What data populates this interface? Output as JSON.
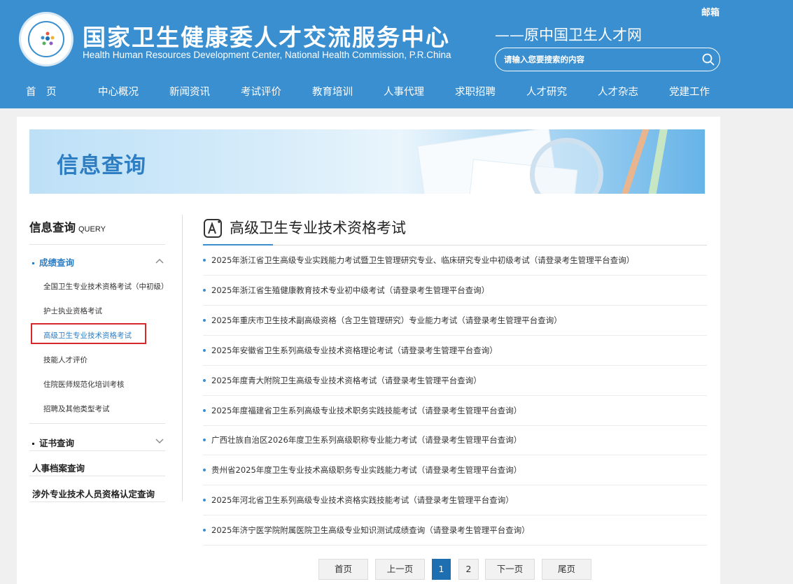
{
  "header": {
    "org_title": "国家卫生健康委人才交流服务中心",
    "org_subtitle": "Health Human Resources Development Center, National Health Commission, P.R.China",
    "tagline": "——原中国卫生人才网",
    "mail": "邮箱",
    "search_placeholder": "请输入您要搜索的内容",
    "nav": [
      "首　页",
      "中心概况",
      "新闻资讯",
      "考试评价",
      "教育培训",
      "人事代理",
      "求职招聘",
      "人才研究",
      "人才杂志",
      "党建工作"
    ]
  },
  "banner": {
    "title": "信息查询"
  },
  "sidebar": {
    "title": "信息查询",
    "title_en": "QUERY",
    "section1": {
      "label": "成绩查询",
      "items": [
        "全国卫生专业技术资格考试（中初级）",
        "护士执业资格考试",
        "高级卫生专业技术资格考试",
        "技能人才评价",
        "住院医师规范化培训考核",
        "招聘及其他类型考试"
      ]
    },
    "section2": {
      "label": "证书查询"
    },
    "item3": "人事档案查询",
    "item4": "涉外专业技术人员资格认定查询"
  },
  "main": {
    "title": "高级卫生专业技术资格考试",
    "items": [
      "2025年浙江省卫生高级专业实践能力考试暨卫生管理研究专业、临床研究专业中初级考试（请登录考生管理平台查询）",
      "2025年浙江省生殖健康教育技术专业初中级考试（请登录考生管理平台查询）",
      "2025年重庆市卫生技术副高级资格（含卫生管理研究）专业能力考试（请登录考生管理平台查询）",
      "2025年安徽省卫生系列高级专业技术资格理论考试（请登录考生管理平台查询）",
      "2025年度青大附院卫生高级专业技术资格考试（请登录考生管理平台查询）",
      "2025年度福建省卫生系列高级专业技术职务实践技能考试（请登录考生管理平台查询）",
      "广西壮族自治区2026年度卫生系列高级职称专业能力考试（请登录考生管理平台查询）",
      "贵州省2025年度卫生专业技术高级职务专业实践能力考试（请登录考生管理平台查询）",
      "2025年河北省卫生系列高级专业技术资格实践技能考试（请登录考生管理平台查询）",
      "2025年济宁医学院附属医院卫生高级专业知识测试成绩查询（请登录考生管理平台查询）"
    ]
  },
  "pagination": {
    "first": "首页",
    "prev": "上一页",
    "pages": [
      "1",
      "2"
    ],
    "current": "1",
    "next": "下一页",
    "last": "尾页"
  },
  "colors": {
    "brand": "#3a8fd0",
    "accent": "#2e7ec3",
    "highlight": "#d9272e"
  }
}
